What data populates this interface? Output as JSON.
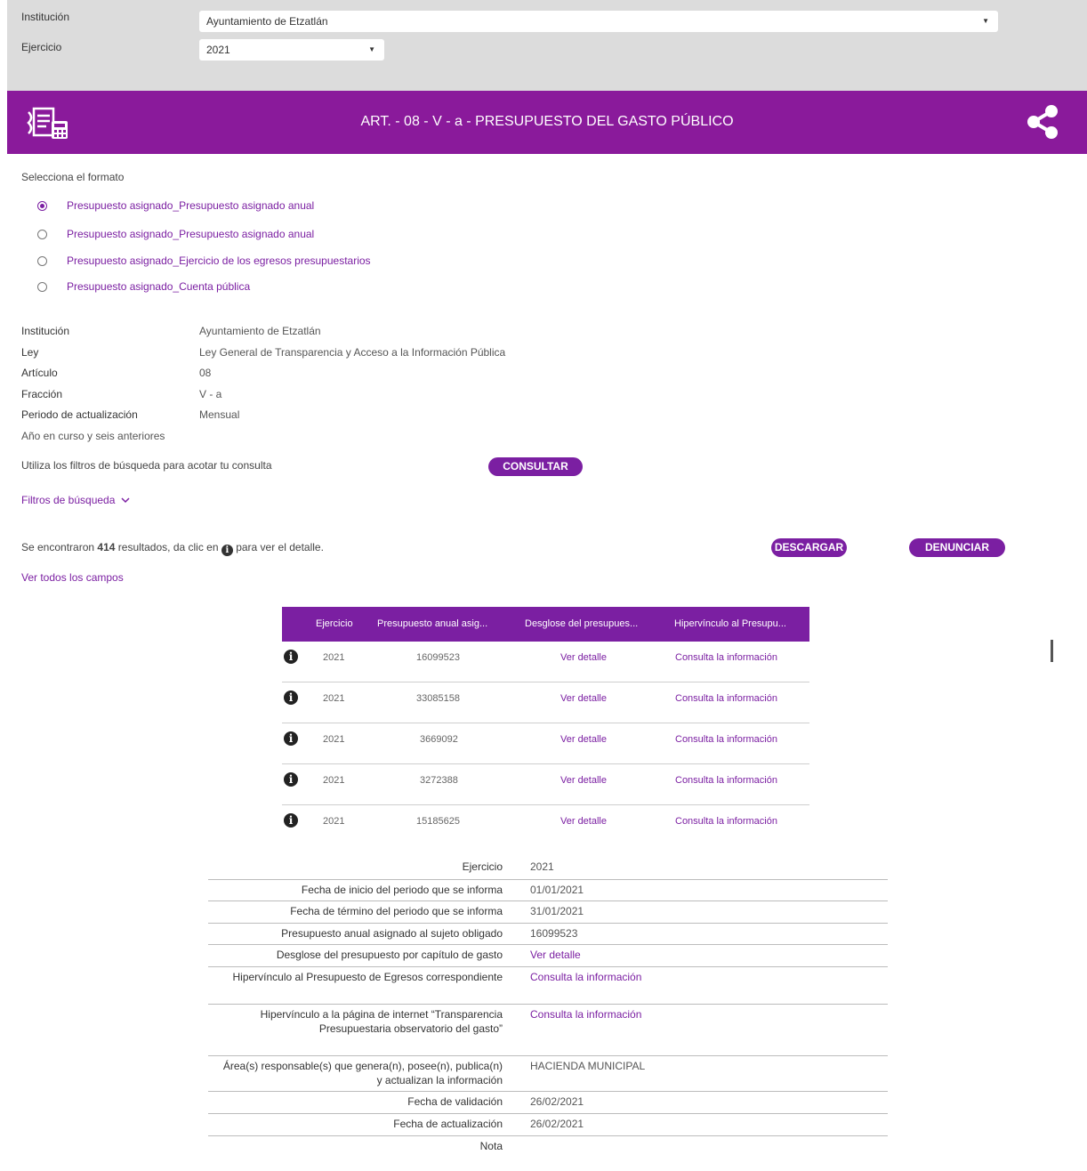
{
  "filters": {
    "institucion_label": "Institución",
    "institucion_value": "Ayuntamiento de Etzatlán",
    "ejercicio_label": "Ejercicio",
    "ejercicio_value": "2021"
  },
  "banner": {
    "title": "ART. - 08 - V - a - PRESUPUESTO DEL GASTO PÚBLICO",
    "color": "#8a1a9b"
  },
  "formats": {
    "label": "Selecciona el formato",
    "options": [
      "Presupuesto asignado_Presupuesto asignado anual",
      "Presupuesto asignado_Presupuesto asignado anual",
      "Presupuesto asignado_Ejercicio de los egresos presupuestarios",
      "Presupuesto asignado_Cuenta pública"
    ],
    "selected_index": 0
  },
  "info": [
    {
      "label": "Institución",
      "value": "Ayuntamiento de Etzatlán"
    },
    {
      "label": "Ley",
      "value": "Ley General de Transparencia y Acceso a la Información Pública"
    },
    {
      "label": "Artículo",
      "value": "08"
    },
    {
      "label": "Fracción",
      "value": "V - a"
    },
    {
      "label": "Periodo de actualización",
      "value": "Mensual"
    }
  ],
  "periodo_note": "Año en curso y seis anteriores",
  "consulta_text": "Utiliza los filtros de búsqueda para acotar tu consulta",
  "buttons": {
    "consultar": "CONSULTAR",
    "descargar": "DESCARGAR",
    "denunciar": "DENUNCIAR"
  },
  "filtros_busqueda": "Filtros de búsqueda",
  "results": {
    "prefix": "Se encontraron",
    "count": "414",
    "middle": "resultados, da clic en",
    "suffix": "para ver el detalle."
  },
  "ver_todos": "Ver todos los campos",
  "table": {
    "headers": [
      "Ejercicio",
      "Presupuesto anual asig...",
      "Desglose del presupues...",
      "Hipervínculo al Presupu..."
    ],
    "rows": [
      {
        "ejercicio": "2021",
        "presupuesto": "16099523",
        "desglose": "Ver detalle",
        "hipervinculo": "Consulta la información"
      },
      {
        "ejercicio": "2021",
        "presupuesto": "33085158",
        "desglose": "Ver detalle",
        "hipervinculo": "Consulta la información"
      },
      {
        "ejercicio": "2021",
        "presupuesto": "3669092",
        "desglose": "Ver detalle",
        "hipervinculo": "Consulta la información"
      },
      {
        "ejercicio": "2021",
        "presupuesto": "3272388",
        "desglose": "Ver detalle",
        "hipervinculo": "Consulta la información"
      },
      {
        "ejercicio": "2021",
        "presupuesto": "15185625",
        "desglose": "Ver detalle",
        "hipervinculo": "Consulta la información"
      }
    ]
  },
  "detail": [
    {
      "label": "Ejercicio",
      "value": "2021",
      "link": false
    },
    {
      "label": "Fecha de inicio del periodo que se informa",
      "value": "01/01/2021",
      "link": false
    },
    {
      "label": "Fecha de término del periodo que se informa",
      "value": "31/01/2021",
      "link": false
    },
    {
      "label": "Presupuesto anual asignado al sujeto obligado",
      "value": "16099523",
      "link": false
    },
    {
      "label": "Desglose del presupuesto por capítulo de gasto",
      "value": "Ver detalle",
      "link": true
    },
    {
      "label": "Hipervínculo al Presupuesto de Egresos correspondiente",
      "value": "Consulta la información",
      "link": true
    },
    {
      "label": "Hipervínculo a la página de internet “Transparencia Presupuestaria observatorio del gasto”",
      "value": "Consulta la información",
      "link": true
    },
    {
      "label": "Área(s) responsable(s) que genera(n), posee(n), publica(n) y actualizan la información",
      "value": "HACIENDA MUNICIPAL",
      "link": false
    },
    {
      "label": "Fecha de validación",
      "value": "26/02/2021",
      "link": false
    },
    {
      "label": "Fecha de actualización",
      "value": "26/02/2021",
      "link": false
    },
    {
      "label": "Nota",
      "value": "",
      "link": false
    }
  ]
}
